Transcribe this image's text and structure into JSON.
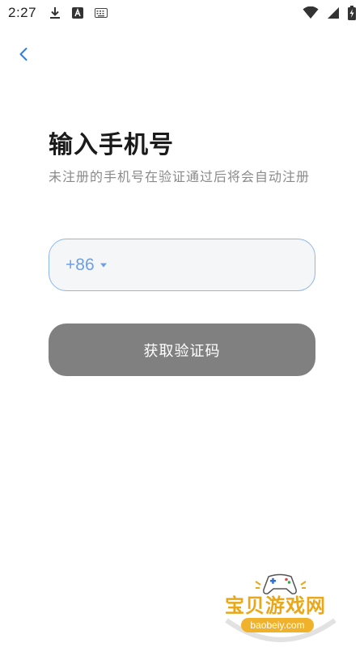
{
  "status_bar": {
    "time": "2:27",
    "left_icons": [
      "download-icon",
      "a-badge-icon",
      "keyboard-icon"
    ],
    "right_icons": [
      "wifi-icon",
      "signal-icon",
      "battery-charging-icon"
    ]
  },
  "header": {
    "back_icon": "chevron-left-icon"
  },
  "main": {
    "title": "输入手机号",
    "subtitle": "未注册的手机号在验证通过后将会自动注册",
    "phone": {
      "country_code": "+86",
      "value": "",
      "placeholder": ""
    },
    "get_code_label": "获取验证码"
  },
  "watermark": {
    "brand": "宝贝游戏网",
    "domain": "baobeiy.com"
  },
  "colors": {
    "accent": "#6f9fe0",
    "field_border": "#8fb6ea",
    "button_disabled": "#808080",
    "subtitle": "#8a8a8a"
  }
}
